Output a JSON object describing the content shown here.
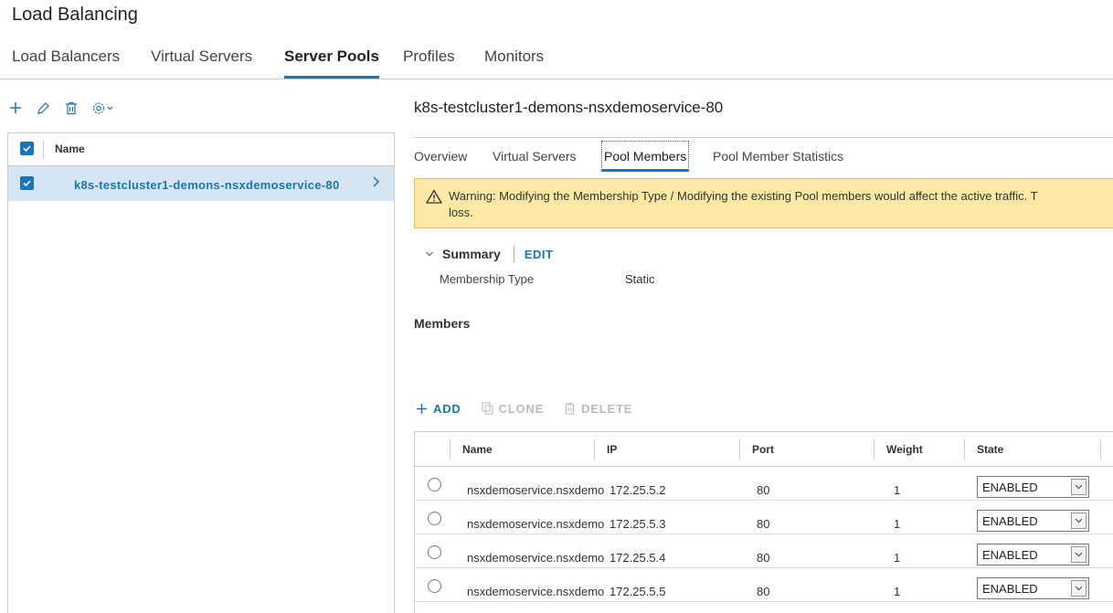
{
  "page": {
    "title": "Load Balancing"
  },
  "main_tabs": [
    {
      "label": "Load Balancers",
      "active": false
    },
    {
      "label": "Virtual Servers",
      "active": false
    },
    {
      "label": "Server Pools",
      "active": true
    },
    {
      "label": "Profiles",
      "active": false
    },
    {
      "label": "Monitors",
      "active": false
    }
  ],
  "toolbar": {
    "icons": [
      "add-icon",
      "edit-icon",
      "delete-icon",
      "gear-icon"
    ]
  },
  "pool_list": {
    "header_label": "Name",
    "items": [
      {
        "label": "k8s-testcluster1-demons-nsxdemoservice-80",
        "selected": true
      }
    ]
  },
  "detail": {
    "title": "k8s-testcluster1-demons-nsxdemoservice-80",
    "tabs": [
      {
        "label": "Overview",
        "active": false
      },
      {
        "label": "Virtual Servers",
        "active": false
      },
      {
        "label": "Pool Members",
        "active": true
      },
      {
        "label": "Pool Member Statistics",
        "active": false
      }
    ],
    "warning": {
      "line1": "Warning: Modifying the Membership Type / Modifying the existing Pool members would affect the active traffic. T",
      "line2": "loss."
    },
    "summary": {
      "title": "Summary",
      "edit_label": "EDIT",
      "membership_type_label": "Membership Type",
      "membership_type_value": "Static"
    },
    "members": {
      "title": "Members",
      "toolbar": {
        "add": "ADD",
        "clone": "CLONE",
        "delete": "DELETE"
      },
      "columns": [
        "Name",
        "IP",
        "Port",
        "Weight",
        "State"
      ],
      "rows": [
        {
          "name": "nsxdemoservice.nsxdemo",
          "ip": "172.25.5.2",
          "port": "80",
          "weight": "1",
          "state": "ENABLED"
        },
        {
          "name": "nsxdemoservice.nsxdemo",
          "ip": "172.25.5.3",
          "port": "80",
          "weight": "1",
          "state": "ENABLED"
        },
        {
          "name": "nsxdemoservice.nsxdemo",
          "ip": "172.25.5.4",
          "port": "80",
          "weight": "1",
          "state": "ENABLED"
        },
        {
          "name": "nsxdemoservice.nsxdemo",
          "ip": "172.25.5.5",
          "port": "80",
          "weight": "1",
          "state": "ENABLED"
        }
      ]
    }
  },
  "colors": {
    "accent": "#1b75bb",
    "warning_bg": "#fde9a4",
    "selected_row": "#d5e6f2"
  }
}
